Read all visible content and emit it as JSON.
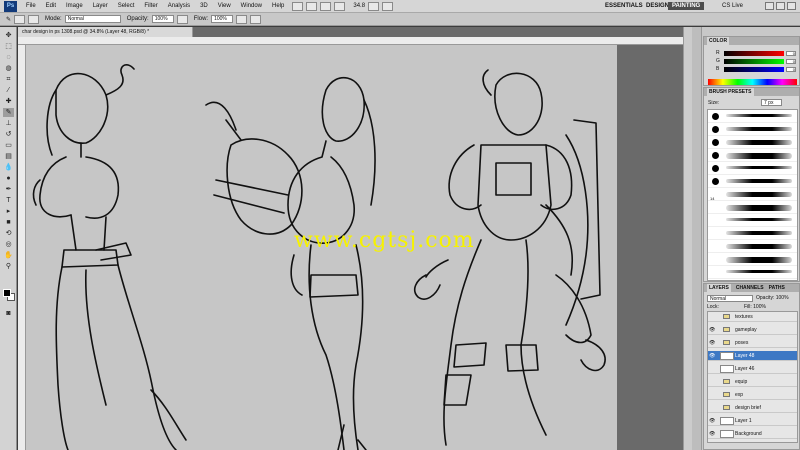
{
  "app": {
    "logo": "Ps"
  },
  "menu": [
    "File",
    "Edit",
    "Image",
    "Layer",
    "Select",
    "Filter",
    "Analysis",
    "3D",
    "View",
    "Window",
    "Help"
  ],
  "zoom_readout": "34.8",
  "workspaces": {
    "essentials": "ESSENTIALS",
    "design": "DESIGN",
    "painting": "PAINTING",
    "cslive": "CS Live"
  },
  "options": {
    "mode_label": "Mode:",
    "mode_value": "Normal",
    "opacity_label": "Opacity:",
    "opacity_value": "100%",
    "flow_label": "Flow:",
    "flow_value": "100%"
  },
  "document": {
    "tab_title": "char design in ps 1308.psd @ 34.8% (Layer 48, RGB/8) *"
  },
  "watermark": "www.cgtsj.com",
  "color_panel": {
    "tabs": [
      "COLOR"
    ],
    "rows": [
      {
        "label": "R",
        "value": "0",
        "gradient": "linear-gradient(90deg,#000,#f00)"
      },
      {
        "label": "G",
        "value": "0",
        "gradient": "linear-gradient(90deg,#000,#0f0)"
      },
      {
        "label": "B",
        "value": "0",
        "gradient": "linear-gradient(90deg,#000,#00f)"
      }
    ]
  },
  "brush_panel": {
    "title": "BRUSH PRESETS",
    "size_label": "Size:",
    "size_value": "7 px",
    "brushes": [
      {
        "num": ""
      },
      {
        "num": ""
      },
      {
        "num": ""
      },
      {
        "num": ""
      },
      {
        "num": ""
      },
      {
        "num": ""
      },
      {
        "num": "14"
      },
      {
        "num": ""
      },
      {
        "num": ""
      },
      {
        "num": ""
      },
      {
        "num": ""
      },
      {
        "num": ""
      },
      {
        "num": ""
      }
    ]
  },
  "layers_panel": {
    "tabs": [
      "LAYERS",
      "CHANNELS",
      "PATHS"
    ],
    "blend_mode": "Normal",
    "opacity_label": "Opacity:",
    "opacity_value": "100%",
    "lock_label": "Lock:",
    "fill_label": "Fill:",
    "fill_value": "100%",
    "layers": [
      {
        "name": "textures",
        "kind": "folder",
        "visible": false
      },
      {
        "name": "gameplay",
        "kind": "folder",
        "visible": true
      },
      {
        "name": "poses",
        "kind": "folder",
        "visible": true
      },
      {
        "name": "Layer 48",
        "kind": "layer",
        "visible": true,
        "selected": true
      },
      {
        "name": "Layer 46",
        "kind": "layer",
        "visible": false
      },
      {
        "name": "equip",
        "kind": "folder",
        "visible": false
      },
      {
        "name": "exp",
        "kind": "folder",
        "visible": false
      },
      {
        "name": "design brief",
        "kind": "folder",
        "visible": false
      },
      {
        "name": "Layer 1",
        "kind": "layer",
        "visible": true
      },
      {
        "name": "Background",
        "kind": "layer",
        "visible": true
      }
    ]
  },
  "colors": {
    "accent_selected": "#3d78c4",
    "watermark": "#f6f200"
  }
}
